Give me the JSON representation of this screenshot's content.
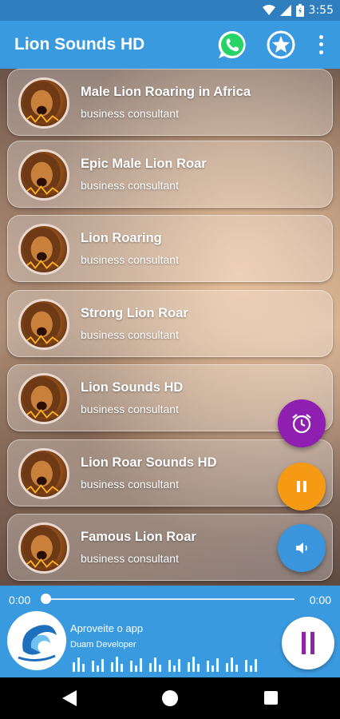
{
  "status_bar": {
    "time": "3:55"
  },
  "app_bar": {
    "title": "Lion Sounds HD"
  },
  "sounds": [
    {
      "title": "Male Lion Roaring in Africa",
      "subtitle": "business consultant"
    },
    {
      "title": "Epic Male Lion Roar",
      "subtitle": "business consultant"
    },
    {
      "title": "Lion Roaring",
      "subtitle": "business consultant"
    },
    {
      "title": "Strong Lion Roar",
      "subtitle": "business consultant"
    },
    {
      "title": "Lion Sounds HD",
      "subtitle": "business consultant"
    },
    {
      "title": "Lion Roar Sounds HD",
      "subtitle": "business consultant"
    },
    {
      "title": "Famous Lion Roar",
      "subtitle": "business consultant"
    }
  ],
  "player": {
    "current_time": "0:00",
    "total_time": "0:00",
    "progress": 0,
    "title": "Aproveite o app",
    "artist": "Duam Developer"
  },
  "colors": {
    "app_bar": "#3a9ae0",
    "status_bar": "#2f7fbf",
    "fab_alarm": "#8e1fb0",
    "fab_pause": "#f59a12",
    "fab_volume": "#3a95dd",
    "pause_icon": "#8e24aa"
  },
  "icons": {
    "app_bar": [
      "whatsapp-icon",
      "star-icon",
      "more-vert-icon"
    ],
    "fabs": [
      "alarm-icon",
      "pause-icon",
      "volume-icon"
    ],
    "nav": [
      "back-icon",
      "home-icon",
      "recents-icon"
    ]
  }
}
